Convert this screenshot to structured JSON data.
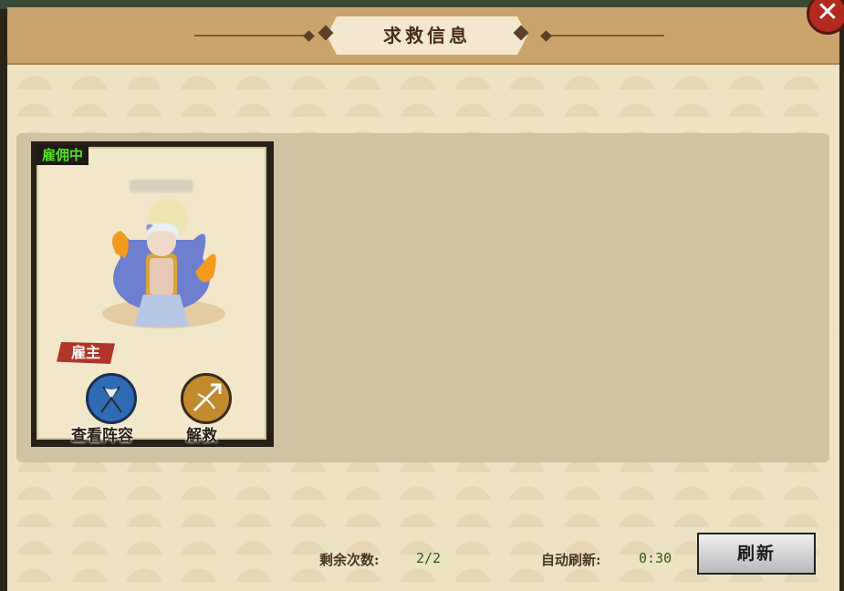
{
  "dialog": {
    "title": "求救信息"
  },
  "card": {
    "status_tag": "雇佣中",
    "role_tag": "雇主",
    "view_lineup_label": "查看阵容",
    "rescue_label": "解救"
  },
  "footer": {
    "remaining_label": "剩余次数:",
    "remaining_value": "2/2",
    "auto_refresh_label": "自动刷新:",
    "auto_refresh_value": "0:30",
    "refresh_button_label": "刷新"
  },
  "colors": {
    "header": "#caa46c",
    "close_button": "#b22a1f",
    "status_green": "#59e02b",
    "host_tag_red": "#b03428"
  }
}
